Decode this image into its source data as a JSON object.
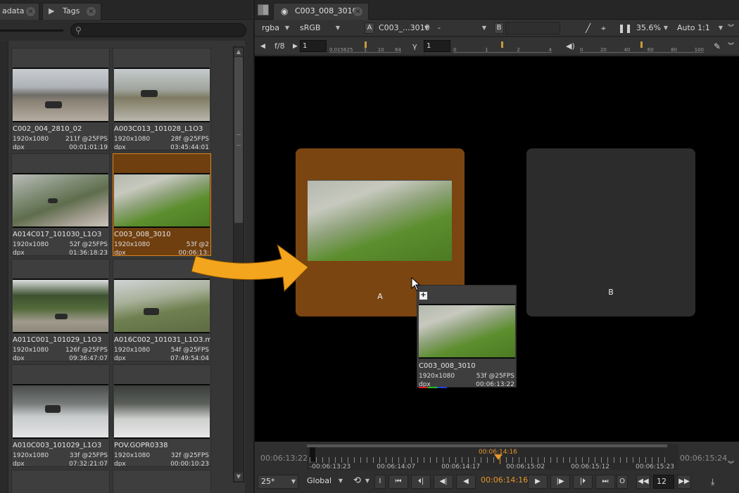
{
  "left_panel": {
    "tabs": [
      {
        "label": "adata"
      },
      {
        "label": "Tags"
      }
    ],
    "clips": [
      {
        "name": "C002_004_2810_02",
        "resolution": "1920x1080",
        "frames": "211f @25FPS",
        "format": "dpx",
        "timecode": "00:01:01:19",
        "selected": false
      },
      {
        "name": "A003C013_101028_L1O3",
        "resolution": "1920x1080",
        "frames": "28f @25FPS",
        "format": "dpx",
        "timecode": "03:45:44:01",
        "selected": false
      },
      {
        "name": "A014C017_101030_L1O3",
        "resolution": "1920x1080",
        "frames": "52f @25FPS",
        "format": "dpx",
        "timecode": "01:36:18:23",
        "selected": false
      },
      {
        "name": "C003_008_3010",
        "resolution": "1920x1080",
        "frames": "53f @2",
        "format": "dpx",
        "timecode": "00:06:13:",
        "selected": true
      },
      {
        "name": "A011C001_101029_L1O3",
        "resolution": "1920x1080",
        "frames": "126f @25FPS",
        "format": "dpx",
        "timecode": "09:36:47:07",
        "selected": false
      },
      {
        "name": "A016C002_101031_L1O3.m",
        "resolution": "1920x1080",
        "frames": "54f @25FPS",
        "format": "dpx",
        "timecode": "07:49:54:04",
        "selected": false
      },
      {
        "name": "A010C003_101029_L1O3",
        "resolution": "1920x1080",
        "frames": "33f @25FPS",
        "format": "dpx",
        "timecode": "07:32:21:07",
        "selected": false
      },
      {
        "name": "POV.GOPR0338",
        "resolution": "1920x1080",
        "frames": "32f @25FPS",
        "format": "dpx",
        "timecode": "00:00:10:23",
        "selected": false
      }
    ]
  },
  "viewer": {
    "tab_label": "C003_008_3010",
    "toolbar1": {
      "channels": "rgba",
      "colorspace": "sRGB",
      "input_a_label": "A",
      "input_a_value": "C003_...3010",
      "operation": "-",
      "input_b_label": "B",
      "zoom": "35.6%",
      "scale": "Auto 1:1"
    },
    "toolbar2": {
      "fstop": "f/8",
      "gain_value": "1",
      "gain_ruler_labels": [
        "0.015625",
        "1",
        "10",
        "64"
      ],
      "gamma_label": "γ",
      "gamma_value": "1",
      "gamma_ruler_labels": [
        "0",
        "1",
        "2",
        "4"
      ],
      "volume_ruler_labels": [
        "0",
        "20",
        "40",
        "60",
        "80",
        "100"
      ]
    },
    "slot_a_label": "A",
    "slot_b_label": "B",
    "drag_card": {
      "name": "C003_008_3010",
      "resolution": "1920x1080",
      "frames": "53f @25FPS",
      "format": "dpx",
      "timecode": "00:06:13:22"
    }
  },
  "timeline": {
    "start_tc": "00:06:13:22",
    "end_tc": "00:06:15:24",
    "current_tc": "00:06:14:16",
    "labels": [
      "-00:06:13:23",
      "00:06:14:07",
      "00:06:14:17",
      "00:06:15:02",
      "00:06:15:12",
      "00:06:15:23"
    ]
  },
  "controls": {
    "fps": "25*",
    "mode": "Global",
    "current_tc": "00:06:14:16",
    "step": "12",
    "in_label": "I",
    "out_label": "O"
  },
  "colors": {
    "accent": "#e8962a",
    "selected_clip": "#6f3f10",
    "slot_a": "#7a4511"
  }
}
